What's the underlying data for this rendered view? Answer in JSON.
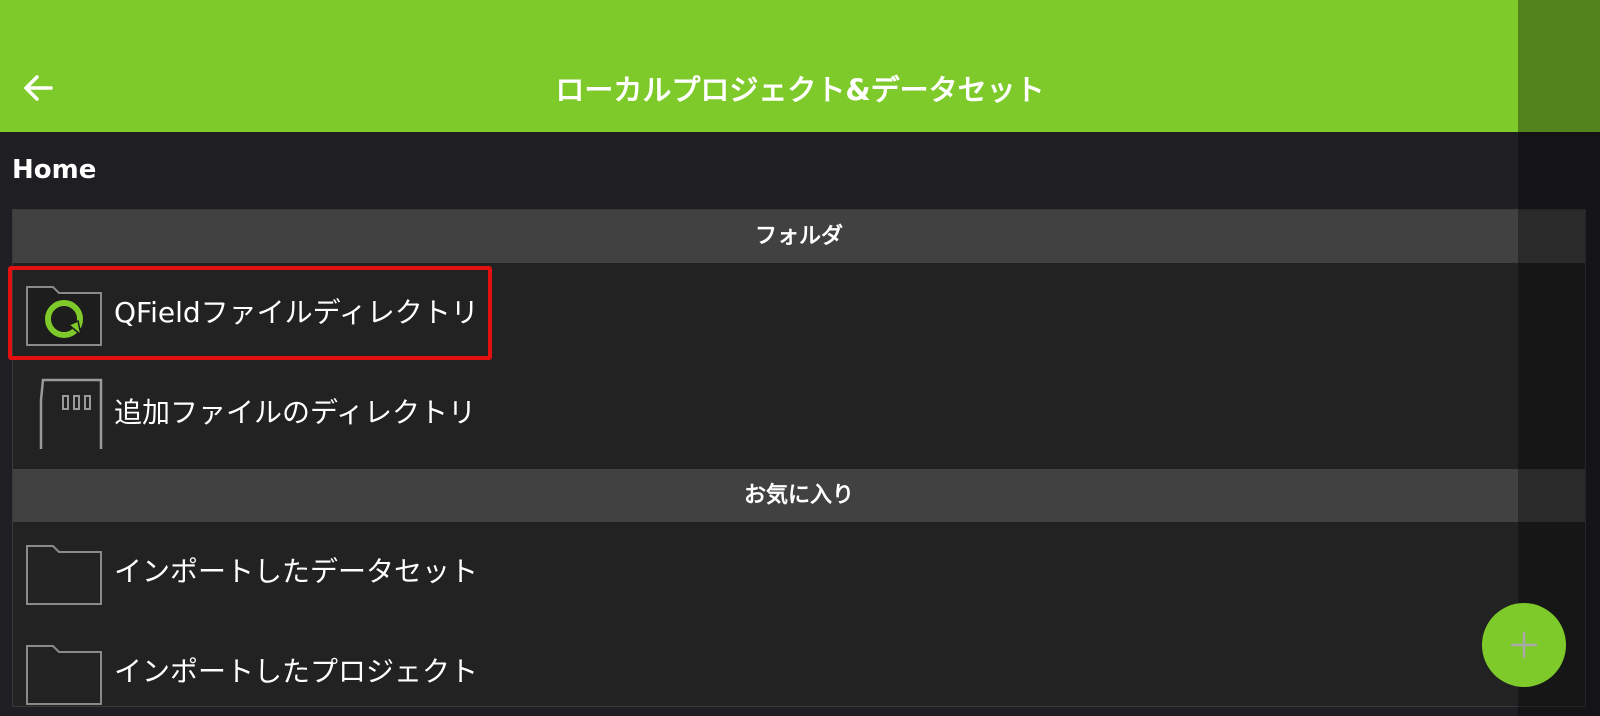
{
  "header": {
    "title": "ローカルプロジェクト&データセット",
    "back_icon": "arrow-left-icon",
    "bar_color": "#7fca2b"
  },
  "breadcrumb": "Home",
  "sections": [
    {
      "title": "フォルダ",
      "items": [
        {
          "label": "QFieldファイルディレクトリ",
          "icon": "qfield-folder-icon"
        },
        {
          "label": "追加ファイルのディレクトリ",
          "icon": "sd-card-icon"
        }
      ]
    },
    {
      "title": "お気に入り",
      "items": [
        {
          "label": "インポートしたデータセット",
          "icon": "folder-icon"
        },
        {
          "label": "インポートしたプロジェクト",
          "icon": "folder-icon"
        }
      ]
    }
  ],
  "fab": {
    "icon": "plus-icon",
    "color": "#7fca2b"
  },
  "highlight_color": "#e3100f"
}
